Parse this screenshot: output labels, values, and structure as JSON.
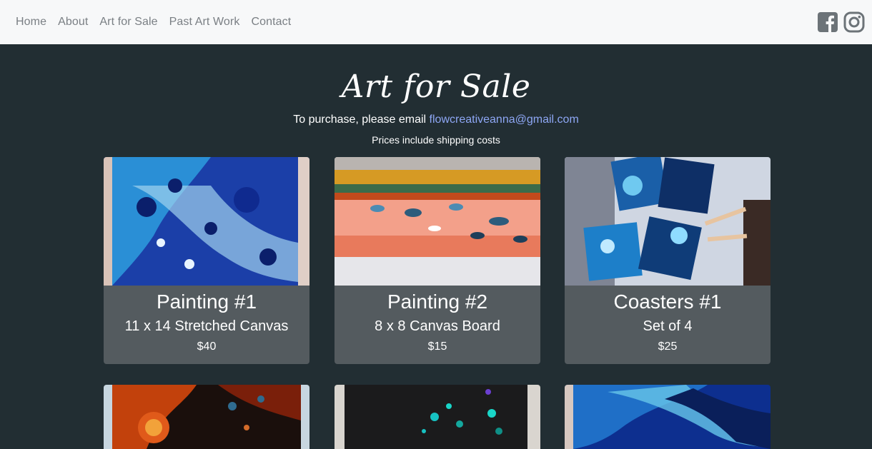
{
  "nav": {
    "links": [
      "Home",
      "About",
      "Art for Sale",
      "Past Art Work",
      "Contact"
    ],
    "icons": [
      "facebook-icon",
      "instagram-icon"
    ]
  },
  "hero": {
    "title": "Art for Sale",
    "purchase_text": "To purchase, please email ",
    "email": "flowcreativeanna@gmail.com",
    "shipping_note": "Prices include shipping costs"
  },
  "cards": [
    {
      "title": "Painting #1",
      "size": "11 x 14 Stretched Canvas",
      "price": "$40"
    },
    {
      "title": "Painting #2",
      "size": "8 x 8 Canvas Board",
      "price": "$15"
    },
    {
      "title": "Coasters #1",
      "size": "Set of 4",
      "price": "$25"
    }
  ],
  "colors": {
    "background": "#222e33",
    "navbar": "#f7f8f9",
    "nav_link": "#7a7f84",
    "card_body": "#545b5f",
    "email_link": "#8ea7f5"
  }
}
